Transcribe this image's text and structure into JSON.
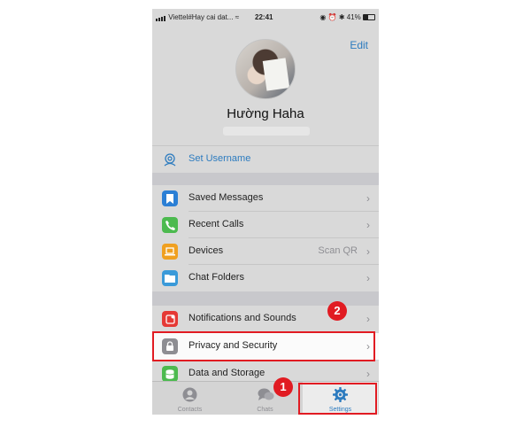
{
  "status_bar": {
    "carrier": "Viettel#Hay cai dat...",
    "time": "22:41",
    "battery": "41%"
  },
  "header": {
    "edit_label": "Edit",
    "name": "Hường Haha"
  },
  "username_row": {
    "label": "Set Username",
    "icon": "at-person-icon"
  },
  "menu_group_1": [
    {
      "label": "Saved Messages",
      "icon": "bookmark-icon",
      "color": "#2b7fd5"
    },
    {
      "label": "Recent Calls",
      "icon": "phone-icon",
      "color": "#4cba4f"
    },
    {
      "label": "Devices",
      "value": "Scan QR",
      "icon": "laptop-icon",
      "color": "#f0a020"
    },
    {
      "label": "Chat Folders",
      "icon": "folder-icon",
      "color": "#3a9ad9"
    }
  ],
  "menu_group_2": [
    {
      "label": "Notifications and Sounds",
      "icon": "bell-icon",
      "color": "#e53935"
    },
    {
      "label": "Privacy and Security",
      "icon": "lock-icon",
      "color": "#8e8e93"
    },
    {
      "label": "Data and Storage",
      "icon": "database-icon",
      "color": "#4cba4f"
    }
  ],
  "tabs": [
    {
      "label": "Contacts",
      "icon": "person-icon",
      "active": false
    },
    {
      "label": "Chats",
      "icon": "chat-bubbles-icon",
      "active": false
    },
    {
      "label": "Settings",
      "icon": "gear-icon",
      "active": true
    }
  ],
  "callouts": {
    "step_1": "1",
    "step_2": "2"
  },
  "colors": {
    "accent": "#2c7bbf",
    "highlight": "#e11b22"
  }
}
